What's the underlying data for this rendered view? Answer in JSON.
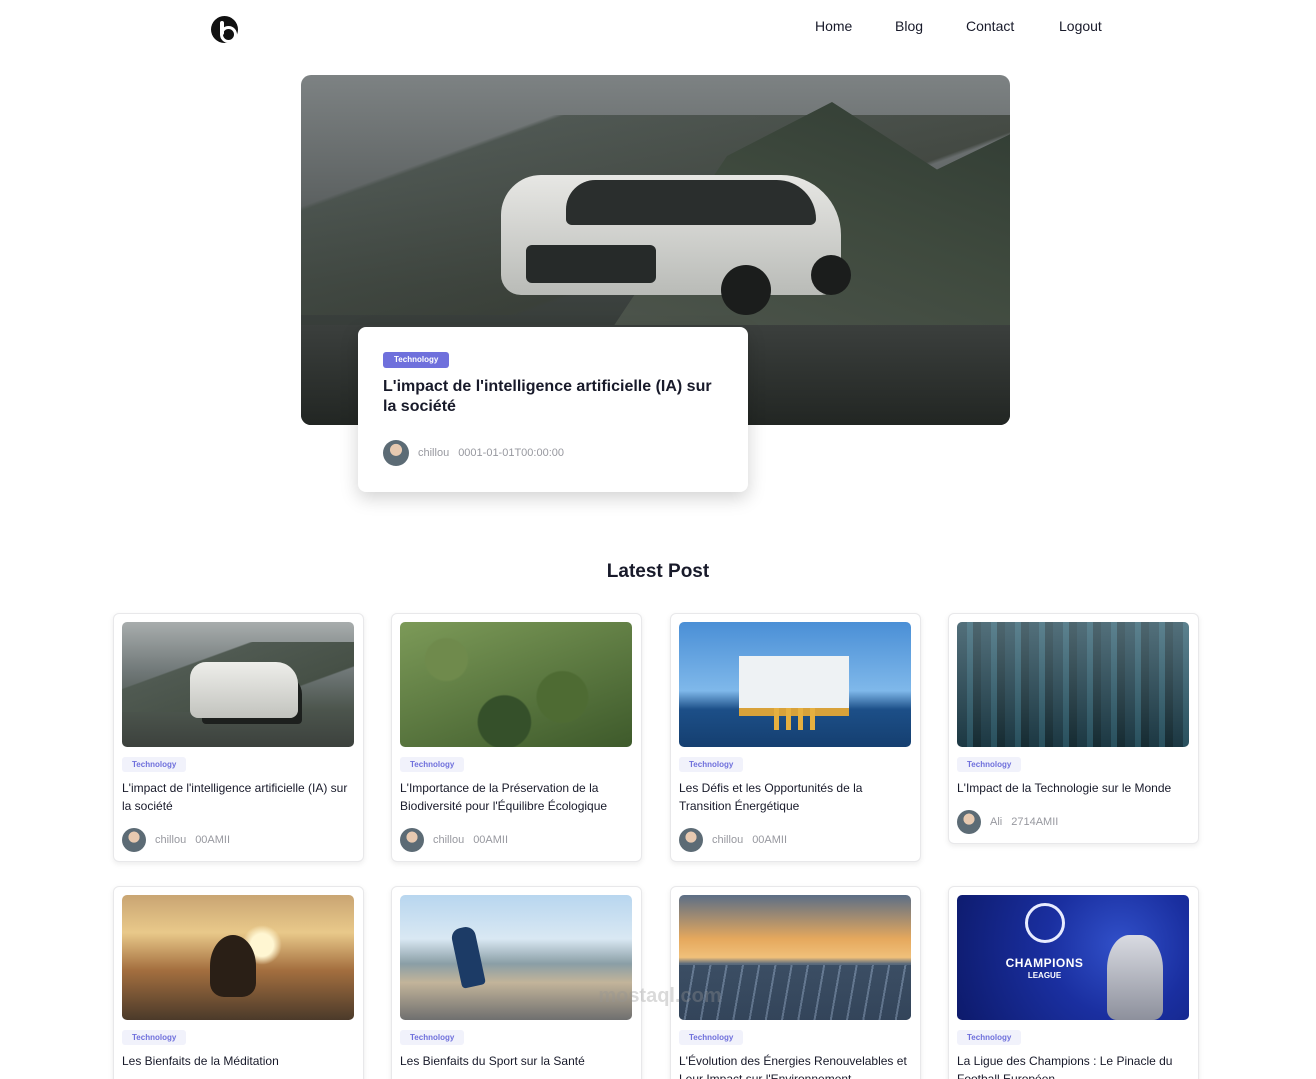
{
  "nav": {
    "links": [
      "Home",
      "Blog",
      "Contact",
      "Logout"
    ]
  },
  "hero": {
    "tag": "Technology",
    "title": "L'impact de l'intelligence artificielle (IA) sur la société",
    "author": "chillou",
    "date": "0001-01-01T00:00:00"
  },
  "section_title": "Latest Post",
  "posts": [
    {
      "tag": "Technology",
      "title": "L'impact de l'intelligence artificielle (IA) sur la société",
      "author": "chillou",
      "date": "00AMII"
    },
    {
      "tag": "Technology",
      "title": "L'Importance de la Préservation de la Biodiversité pour l'Équilibre Écologique",
      "author": "chillou",
      "date": "00AMII"
    },
    {
      "tag": "Technology",
      "title": "Les Défis et les Opportunités de la Transition Énergétique",
      "author": "chillou",
      "date": "00AMII"
    },
    {
      "tag": "Technology",
      "title": "L'Impact de la Technologie sur le Monde",
      "author": "Ali",
      "date": "2714AMII"
    },
    {
      "tag": "Technology",
      "title": "Les Bienfaits de la Méditation",
      "author": "",
      "date": ""
    },
    {
      "tag": "Technology",
      "title": "Les Bienfaits du Sport sur la Santé",
      "author": "",
      "date": ""
    },
    {
      "tag": "Technology",
      "title": "L'Évolution des Énergies Renouvelables et Leur Impact sur l'Environnement",
      "author": "",
      "date": ""
    },
    {
      "tag": "Technology",
      "title": "La Ligue des Champions : Le Pinacle du Football Européen",
      "author": "",
      "date": ""
    }
  ],
  "ucl_logo": {
    "line1": "CHAMPIONS",
    "line2": "LEAGUE"
  },
  "watermark": "mostaql.com",
  "colors": {
    "accent": "#6f70dc",
    "text": "#181a2a",
    "meta": "#97989f"
  }
}
